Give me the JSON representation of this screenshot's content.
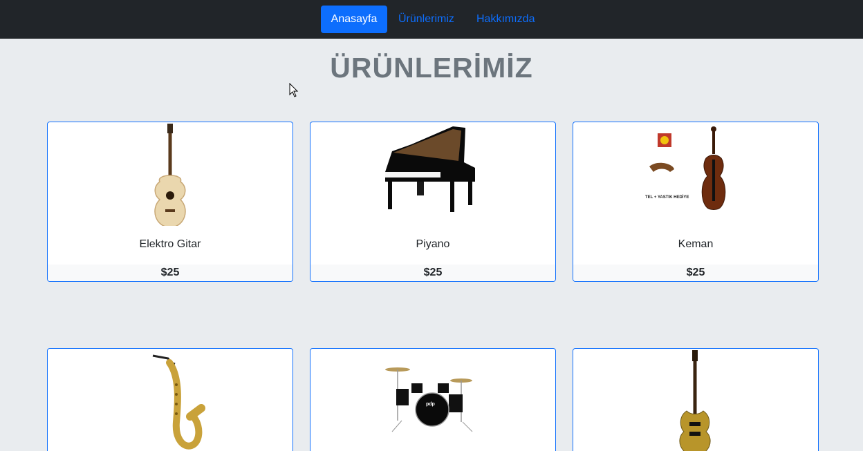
{
  "navbar": {
    "items": [
      {
        "label": "Anasayfa",
        "active": true
      },
      {
        "label": "Ürünlerimiz",
        "active": false
      },
      {
        "label": "Hakkımızda",
        "active": false
      }
    ]
  },
  "page": {
    "title": "ÜRÜNLERİMİZ"
  },
  "products": [
    {
      "name": "Elektro Gitar",
      "price": "$25",
      "icon": "acoustic-guitar-icon"
    },
    {
      "name": "Piyano",
      "price": "$25",
      "icon": "grand-piano-icon"
    },
    {
      "name": "Keman",
      "price": "$25",
      "icon": "violin-icon",
      "image_caption": "TEL + YASTIK HEDİYE"
    },
    {
      "name": "",
      "price": "",
      "icon": "saxophone-icon"
    },
    {
      "name": "",
      "price": "",
      "icon": "drum-kit-icon",
      "image_caption": "pdp"
    },
    {
      "name": "",
      "price": "",
      "icon": "electric-guitar-icon"
    }
  ],
  "colors": {
    "accent": "#0d6efd",
    "navbar_bg": "#212529",
    "page_bg": "#e9ecef",
    "title": "#6c757d"
  }
}
